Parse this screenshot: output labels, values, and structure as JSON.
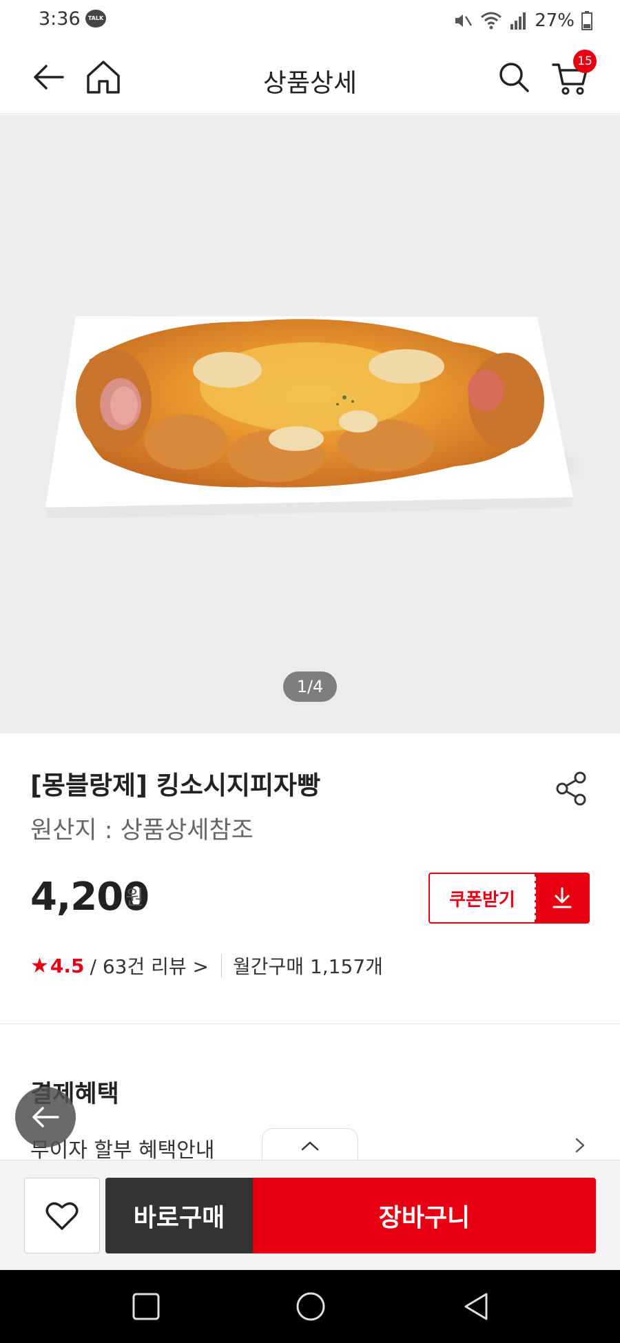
{
  "status_bar": {
    "time": "3:36",
    "talk_badge": "TALK",
    "battery": "27%"
  },
  "header": {
    "title": "상품상세",
    "cart_count": "15"
  },
  "hero": {
    "pager": "1/4"
  },
  "product": {
    "name": "[몽블랑제] 킹소시지피자빵",
    "origin": "원산지 : 상품상세참조",
    "price": "4,200",
    "price_unit": "원",
    "coupon_label": "쿠폰받기",
    "rating_star": "★",
    "rating": "4.5",
    "reviews": "/ 63건 리뷰 >",
    "monthly_purchase": "월간구매 1,157개"
  },
  "benefit": {
    "title": "결제혜택",
    "installment": "무이자 할부 혜택안내"
  },
  "action_bar": {
    "buy_now": "바로구매",
    "add_to_cart": "장바구니"
  },
  "colors": {
    "accent": "#e60012",
    "dark_button": "#333333"
  }
}
